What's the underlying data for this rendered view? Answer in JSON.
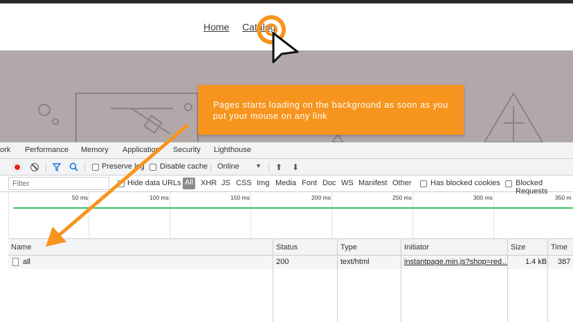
{
  "site": {
    "nav": {
      "home": "Home",
      "catalog": "Catalog"
    },
    "callout": "Pages starts loading on the background as soon as you put your mouse on any link"
  },
  "devtools": {
    "tabs": [
      "ork",
      "Performance",
      "Memory",
      "Application",
      "Security",
      "Lighthouse"
    ],
    "toolbar": {
      "preserve_log": "Preserve log",
      "disable_cache": "Disable cache",
      "throttle": "Online"
    },
    "filterbar": {
      "filter_placeholder": "Filter",
      "hide_data_urls": "Hide data URLs",
      "types": [
        "All",
        "XHR",
        "JS",
        "CSS",
        "Img",
        "Media",
        "Font",
        "Doc",
        "WS",
        "Manifest",
        "Other"
      ],
      "has_blocked_cookies": "Has blocked cookies",
      "blocked_requests": "Blocked Requests"
    },
    "timeline": {
      "ticks": [
        "50 ms",
        "100 ms",
        "150 ms",
        "200 ms",
        "250 ms",
        "300 ms",
        "350 m"
      ]
    },
    "table": {
      "headers": [
        "Name",
        "Status",
        "Type",
        "Initiator",
        "Size",
        "Time"
      ],
      "rows": [
        {
          "name": "all",
          "status": "200",
          "type": "text/html",
          "initiator": "instantpage.min.js?shop=red…",
          "size": "1.4 kB",
          "time": "387"
        }
      ]
    }
  },
  "colors": {
    "accent": "#f7941d",
    "hero_bg": "#b3a8a9",
    "record": "#e8221c",
    "timeline_green": "#36c25c"
  }
}
